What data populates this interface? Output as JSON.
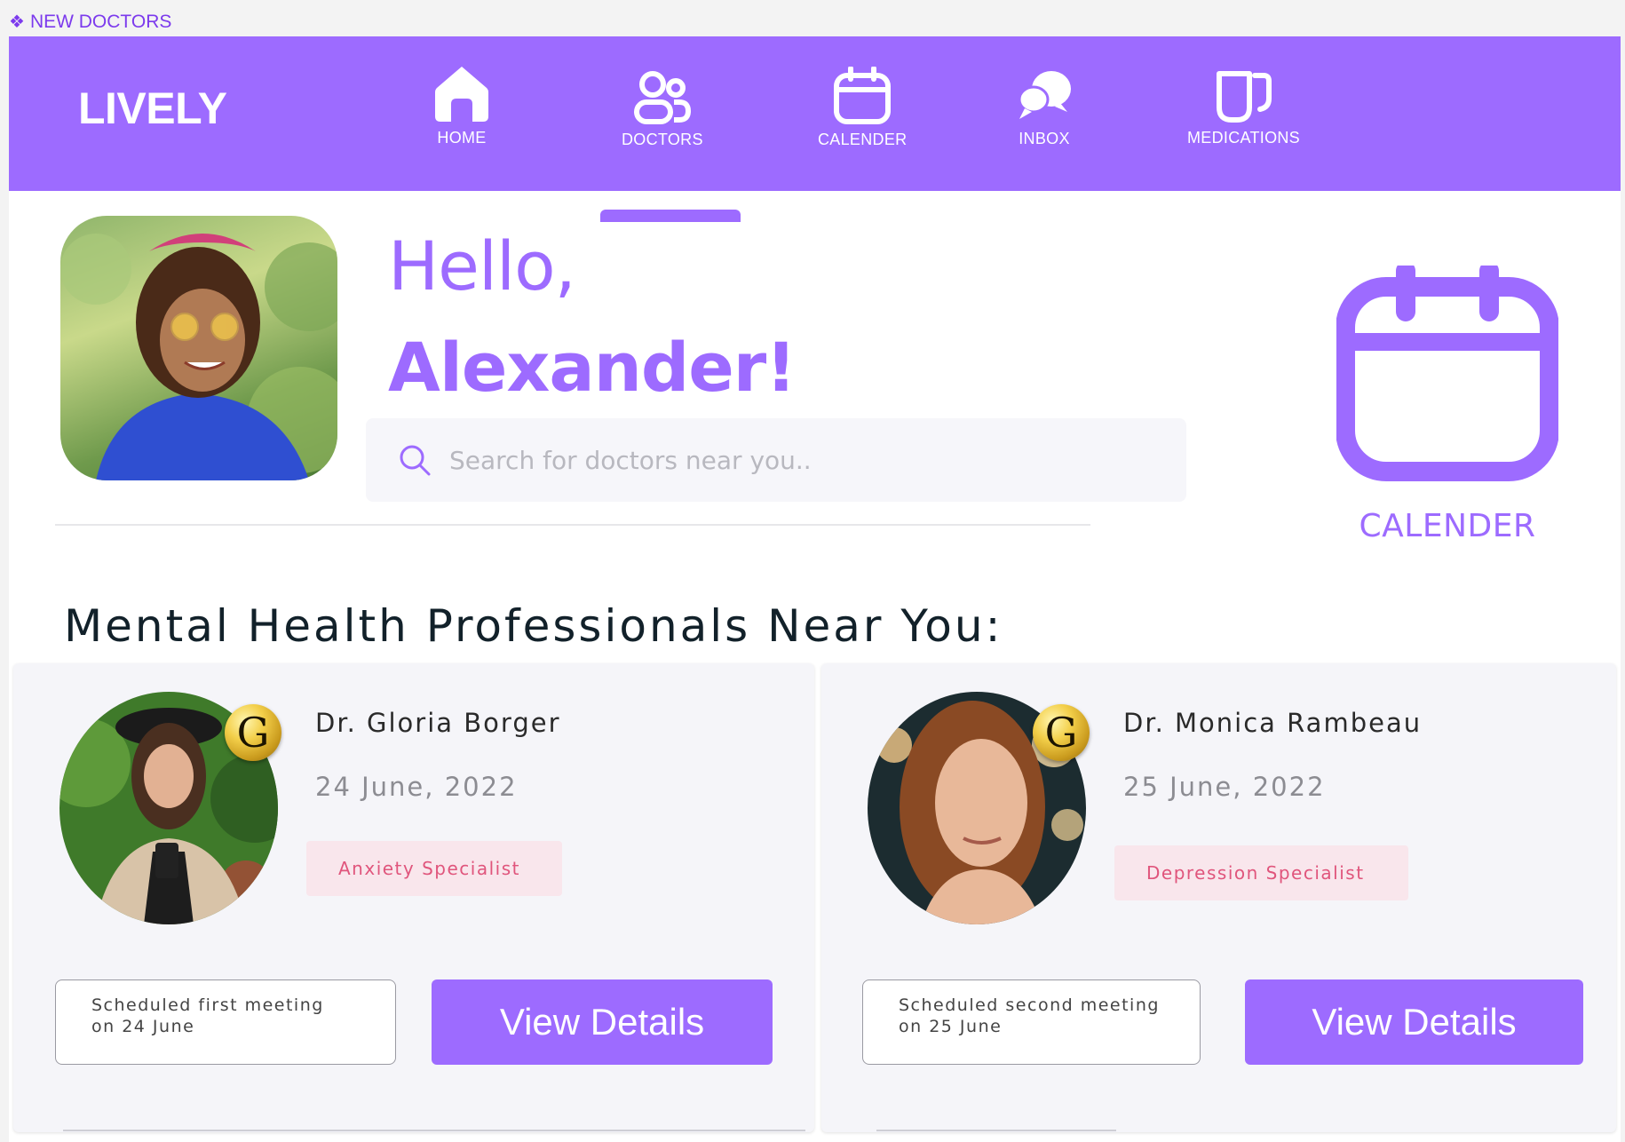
{
  "frame": {
    "label": "NEW DOCTORS",
    "icon": "component-diamond-icon"
  },
  "brand": {
    "name": "LIVELY",
    "color": "#9d6bff"
  },
  "nav": {
    "items": [
      {
        "label": "HOME",
        "icon": "home-icon"
      },
      {
        "label": "DOCTORS",
        "icon": "users-icon",
        "active": true
      },
      {
        "label": "CALENDER",
        "icon": "calendar-icon"
      },
      {
        "label": "INBOX",
        "icon": "chat-bubbles-icon"
      },
      {
        "label": "MEDICATIONS",
        "icon": "mugs-icon"
      }
    ]
  },
  "hero": {
    "greeting": "Hello,",
    "name": "Alexander!",
    "search_placeholder": "Search for doctors near you..",
    "calendar_label": "CALENDER"
  },
  "section": {
    "title": "Mental Health Professionals Near You:"
  },
  "doctors": [
    {
      "name": "Dr. Gloria Borger",
      "date": "24 June, 2022",
      "specialty": "Anxiety Specialist",
      "badge": "G",
      "meeting_line1": "Scheduled first meeting",
      "meeting_line2": "on 24 June",
      "button": "View Details"
    },
    {
      "name": "Dr. Monica Rambeau",
      "date": "25 June, 2022",
      "specialty": "Depression Specialist",
      "badge": "G",
      "meeting_line1": "Scheduled second meeting",
      "meeting_line2": "on 25 June",
      "button": "View Details"
    }
  ],
  "colors": {
    "accent": "#9d6bff",
    "badge_bg": "#f9e6ec",
    "badge_text": "#e0557c",
    "card_bg": "#f5f5f9"
  }
}
